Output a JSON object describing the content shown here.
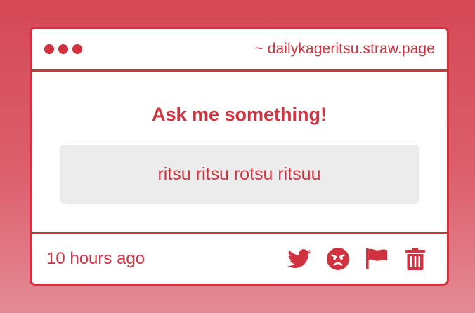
{
  "window": {
    "url": "~ dailykageritsu.straw.page"
  },
  "main": {
    "heading": "Ask me something!",
    "question": "ritsu ritsu rotsu ritsuu"
  },
  "footer": {
    "timestamp": "10 hours ago",
    "actions": [
      {
        "icon": "twitter-icon"
      },
      {
        "icon": "angry-face-icon"
      },
      {
        "icon": "flag-icon"
      },
      {
        "icon": "trash-icon"
      }
    ]
  },
  "colors": {
    "accent": "#d0333f",
    "background_top": "#d54856",
    "background_bottom": "#e48a95",
    "card": "#ffffff",
    "question_box": "#ececec"
  }
}
